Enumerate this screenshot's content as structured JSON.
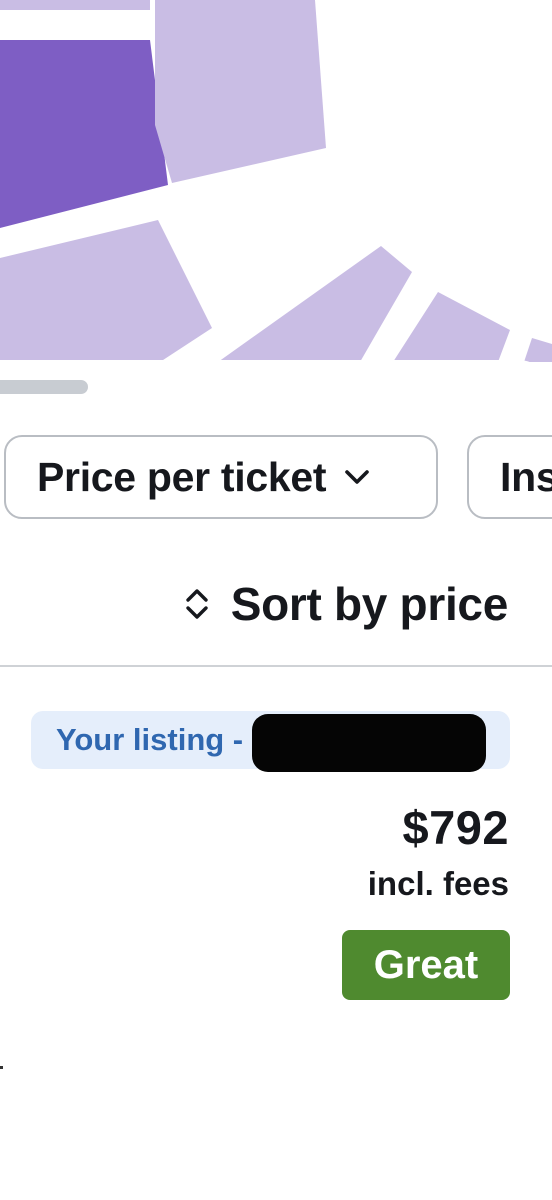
{
  "colors": {
    "section_light": "#c9bde4",
    "section_selected": "#7e5ec4",
    "map_gap": "#ffffff",
    "badge_bg": "#e5eefb",
    "badge_text": "#2f67b0",
    "deal_green": "#4f8a2f",
    "text_primary": "#16181d"
  },
  "filters": {
    "price_per_ticket_label": "Price per ticket",
    "price_chevron_icon": "chevron-down-icon",
    "instant_label_partial": "Ins"
  },
  "sort": {
    "label": "Sort by price",
    "icon": "up-down-chevron-icon"
  },
  "listing": {
    "badge_text": "Your listing -",
    "price": "$792",
    "fees_note": "incl. fees",
    "deal_rating": "Great"
  }
}
